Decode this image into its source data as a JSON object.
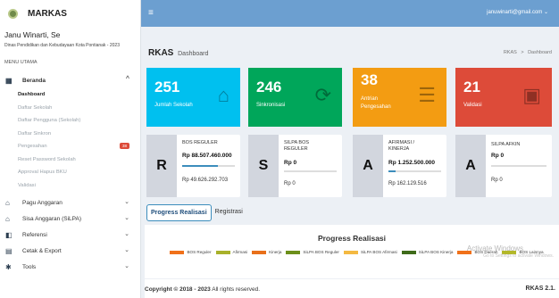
{
  "app": {
    "name": "MARKAS"
  },
  "user": {
    "name": "Janu Winarti, Se",
    "org": "Dinas Pendidikan dan Kebudayaan Kota Pontianak - 2023",
    "email": "januwinarti@gmail.com"
  },
  "sidebar": {
    "header": "MENU UTAMA",
    "beranda": {
      "label": "Beranda",
      "subitems": [
        {
          "label": "Dashboard"
        },
        {
          "label": "Daftar Sekolah"
        },
        {
          "label": "Daftar Pengguna (Sekolah)"
        },
        {
          "label": "Daftar Sinkron"
        },
        {
          "label": "Pengesahan",
          "badge": "38"
        },
        {
          "label": "Reset Password Sekolah"
        },
        {
          "label": "Approval Hapus BKU"
        },
        {
          "label": "Validasi"
        }
      ]
    },
    "items": [
      {
        "label": "Pagu Anggaran"
      },
      {
        "label": "Sisa Anggaran (SiLPA)"
      },
      {
        "label": "Referensi"
      },
      {
        "label": "Cetak & Export"
      },
      {
        "label": "Tools"
      }
    ]
  },
  "page": {
    "title": "RKAS",
    "subtitle": "Dashboard",
    "breadcrumb": [
      "RKAS",
      ">",
      "Dashboard"
    ]
  },
  "stats": [
    {
      "value": "251",
      "label": "Jumlah Sekolah",
      "color": "#00c0ef"
    },
    {
      "value": "246",
      "label": "Sinkronisasi",
      "color": "#00a65a"
    },
    {
      "value": "38",
      "label": "Antrian Pengesahan",
      "color": "#f39c12"
    },
    {
      "value": "21",
      "label": "Validasi",
      "color": "#dd4b39"
    }
  ],
  "finance": [
    {
      "letter": "R",
      "title": "BOS REGULER",
      "amount": "Rp 88.507.460.000",
      "sub": "Rp 49.626.292.703"
    },
    {
      "letter": "S",
      "title": "SILPA BOS REGULER",
      "amount": "Rp 0",
      "sub": "Rp 0"
    },
    {
      "letter": "A",
      "title": "AFIRMASI / KINERJA",
      "amount": "Rp 1.252.500.000",
      "sub": "Rp 162.129.516"
    },
    {
      "letter": "A",
      "title": "SILPA AFKIN",
      "amount": "Rp 0",
      "sub": "Rp 0"
    }
  ],
  "tabs": [
    "Progress Realisasi",
    "Registrasi"
  ],
  "chart_data": {
    "type": "bar",
    "title": "Progress Realisasi",
    "series": [
      {
        "name": "BOS Reguler",
        "color": "#f0711a"
      },
      {
        "name": "Afirmasi",
        "color": "#a8b12b"
      },
      {
        "name": "Kinerja",
        "color": "#e8701a"
      },
      {
        "name": "SiLPA BOS Reguler",
        "color": "#6c8f1a"
      },
      {
        "name": "SiLPA BOS Afirmasi",
        "color": "#f4b942"
      },
      {
        "name": "SiLPA BOS Kinerja",
        "color": "#3f6b1a"
      },
      {
        "name": "BOS Daerah",
        "color": "#f0711a"
      },
      {
        "name": "BOS Lainnya",
        "color": "#b3b82a"
      }
    ]
  },
  "watermark": {
    "line1": "Activate Windows",
    "line2": "Go to Settings to activate Windows."
  },
  "footer": {
    "prefix": "Copyright © 2018 - 2023",
    "suffix": "All rights reserved.",
    "version": "RKAS 2.1."
  }
}
